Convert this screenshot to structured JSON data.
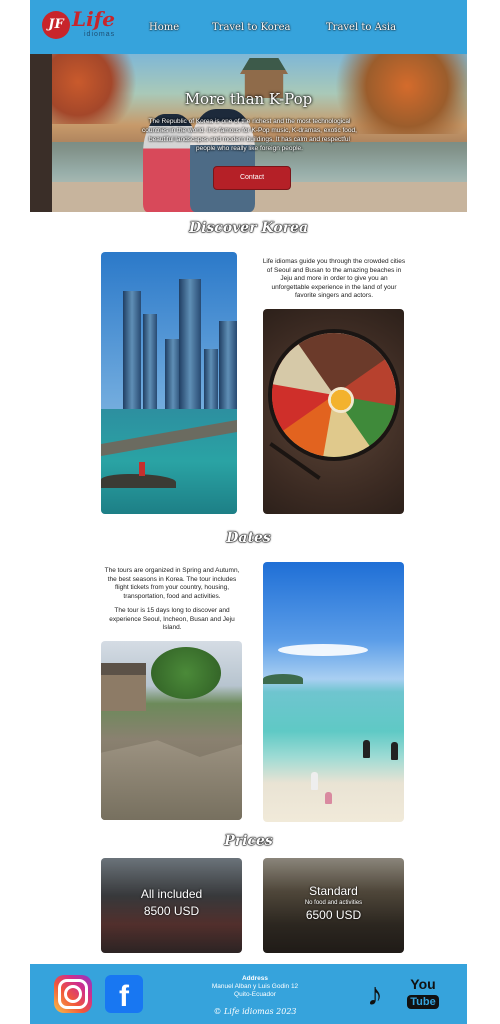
{
  "header": {
    "logo_mark": "JF",
    "logo_word": "Life",
    "logo_sub": "idiomas",
    "nav": [
      "Home",
      "Travel to Korea",
      "Travel to Asia"
    ]
  },
  "hero": {
    "title": "More than K-Pop",
    "text": "The Republic of Korea is one of the richest and the most technological countries in the world. It is famous for K-Pop music, K-dramas, exotic food, beautiful landscapes and modern buildings. It has calm and respectful people who really like foreign people.",
    "button": "Contact"
  },
  "discover": {
    "title": "Discover Korea",
    "text": "Life idiomas guide you through the crowded cities of Seoul and Busan to the amazing beaches in Jeju and more in order to give you an unforgettable experience in the land of your favorite singers and actors."
  },
  "dates": {
    "title": "Dates",
    "text1": "The tours are organized in Spring and Autumn, the best seasons in Korea. The tour includes flight tickets from your country, housing, transportation, food and activities.",
    "text2": "The tour is 15 days long to discover and experience Seoul, Incheon, Busan and Jeju Island."
  },
  "prices": {
    "title": "Prices",
    "plans": [
      {
        "name": "All included",
        "note": "",
        "price": "8500 USD"
      },
      {
        "name": "Standard",
        "note": "No food and activities",
        "price": "6500 USD"
      }
    ]
  },
  "footer": {
    "address_title": "Address",
    "address_line1": "Manuel Alban y Luis Godin 12",
    "address_line2": "Quito-Ecuador",
    "copyright": "© Life idiomas 2023",
    "social": [
      "instagram-icon",
      "facebook-icon",
      "tiktok-icon",
      "youtube-icon"
    ],
    "youtube_you": "You",
    "youtube_tube": "Tube"
  },
  "colors": {
    "header_blue": "#36a3dc",
    "brand_red": "#c8252b",
    "button_red": "#b52027"
  }
}
